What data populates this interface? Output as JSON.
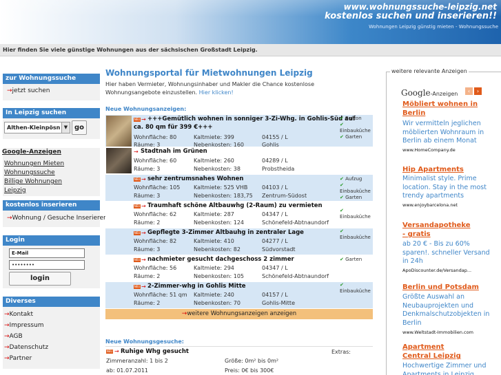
{
  "header": {
    "url": "www.wohnungssuche-leipzig.net",
    "slogan": "kostenlos suchen und inserieren!!",
    "subline": "Wohnungen Leipzig günstig mieten - Wohnungssuche"
  },
  "intro": "Hier finden Sie viele günstige Wohnungen aus der sächsischen Großstadt Leipzig.",
  "sidebar": {
    "search_head": "zur Wohnungssuche",
    "search_link": "jetzt suchen",
    "city_head": "In Leipzig suchen",
    "district_value": "Althen-Kleinpösn",
    "go_label": "go",
    "google_head": "Google-Anzeigen",
    "google_links": [
      "Wohnungen Mieten",
      "Wohnungssuche",
      "Billige Wohnungen",
      "Leipzig"
    ],
    "insert_head": "kostenlos inserieren",
    "insert_link": "Wohnung / Gesuche  Inserieren",
    "login_head": "Login",
    "email_value": "E-Mail",
    "password_value": "••••••••",
    "login_label": "login",
    "misc_head": "Diverses",
    "misc_links": [
      "Kontakt",
      "Impressum",
      "AGB",
      "Datenschutz",
      "Partner"
    ]
  },
  "main": {
    "title": "Wohnungsportal für Mietwohnungen Leipzig",
    "desc": "Hier haben Vermieter, Wohnungsinhaber und Makler die Chance kostenlose Wohnungsangebote einzustellen.",
    "desc_link": "Hier klicken!",
    "offers_label": "Neue Wohnungsanzeigen:",
    "requests_label": "Neue Wohnungsgesuche:",
    "more_link": "weitere Wohnungsanzeigen anzeigen",
    "badge_text": "NEU",
    "listings": [
      {
        "title": "+++Gemütlich wohnen in sonniger 3-Zi-Whg. in Gohlis-Süd auf",
        "title2": "ca. 80 qm für 399 €+++",
        "wf": "Wohnfläche: 80",
        "rooms": "Räume: 3",
        "km": "Kaltmiete: 399",
        "nk": "Nebenkosten: 160",
        "plz": "04155 / L",
        "area": "Gohlis",
        "features": [
          "Balkon",
          "Einbauküche",
          "Garten"
        ]
      },
      {
        "title": "Stadtnah im Grünen",
        "wf": "Wohnfläche: 60",
        "rooms": "Räume: 3",
        "km": "Kaltmiete: 260",
        "nk": "Nebenkosten: 38",
        "plz": "04289 / L",
        "area": "Probstheida",
        "features": []
      },
      {
        "title": "sehr zentrumsnahes Wohnen",
        "wf": "Wohnfläche: 105",
        "rooms": "Räume: 3",
        "km": "Kaltmiete: 525 VHB",
        "nk": "Nebenkosten: 183,75",
        "plz": "04103 / L",
        "area": "Zentrum-Südost",
        "features": [
          "Aufzug",
          "Einbauküche",
          "Garten"
        ]
      },
      {
        "title": "Traumhaft schöne Altbauwhg (2-Raum) zu vermieten",
        "wf": "Wohnfläche: 62",
        "rooms": "Räume: 2",
        "km": "Kaltmiete: 287",
        "nk": "Nebenkosten: 124",
        "plz": "04347 / L",
        "area": "Schönefeld-Abtnaundorf",
        "features": [
          "Einbauküche"
        ]
      },
      {
        "title": "Gepflegte 3-Zimmer Altbauhg in zentraler Lage",
        "wf": "Wohnfläche: 82",
        "rooms": "Räume: 3",
        "km": "Kaltmiete: 410",
        "nk": "Nebenkosten: 82",
        "plz": "04277 / L",
        "area": "Südvorstadt",
        "features": [
          "Einbauküche"
        ]
      },
      {
        "title": "nachmieter gesucht dachgeschoss 2 zimmer",
        "wf": "Wohnfläche: 56",
        "rooms": "Räume: 2",
        "km": "Kaltmiete: 294",
        "nk": "Nebenkosten: 105",
        "plz": "04347 / L",
        "area": "Schönefeld-Abtnaundorf",
        "features": [
          "Garten"
        ]
      },
      {
        "title": "2-Zimmer-whg in Gohlis Mitte",
        "wf": "Wohnfläche: 51 qm",
        "rooms": "Räume: 2",
        "km": "Kaltmiete: 240",
        "nk": "Nebenkosten: 70",
        "plz": "04157 / L",
        "area": "Gohlis-Mitte",
        "features": [
          "Einbauküche"
        ]
      }
    ],
    "request": {
      "title": "Ruhige Whg gesucht",
      "extras": "Extras:",
      "rooms": "Zimmeranzahl: 1 bis 2",
      "size": "Größe: 0m² bis 0m²",
      "from": "ab: 01.07.2011",
      "price": "Preis: 0€ bis 300€"
    }
  },
  "ads": {
    "label": "weitere relevante Anzeigen",
    "brand": "Google",
    "brand_suffix": "-Anzeigen",
    "items": [
      {
        "title": "Möbliert wohnen in Berlin",
        "text": "Wir vermitteln jeglichen möblierten Wohnraum in Berlin ab einem Monat",
        "url": "www.HomeCompany.de"
      },
      {
        "title": "Hip Apartments",
        "text": "Minimalist style. Prime location. Stay in the most trendy apartments",
        "url": "www.enjoybarcelona.net"
      },
      {
        "title": "Versandapotheke - gratis",
        "text": "ab 20 € - Bis zu 60% sparen!. schneller Versand in 24h",
        "url": "ApoDiscounter.de/Versandap..."
      },
      {
        "title": "Berlin und Potsdam",
        "text": "Größte Auswahl an Neubauprojekten und Denkmalschutzobjekten in Berlin",
        "url": "www.Weltstadt-Immobilien.com"
      },
      {
        "title": "Apartment Central Leipzig",
        "text": "Hochwertige Zimmer und Apartments in Leipzig",
        "url": ""
      }
    ]
  }
}
